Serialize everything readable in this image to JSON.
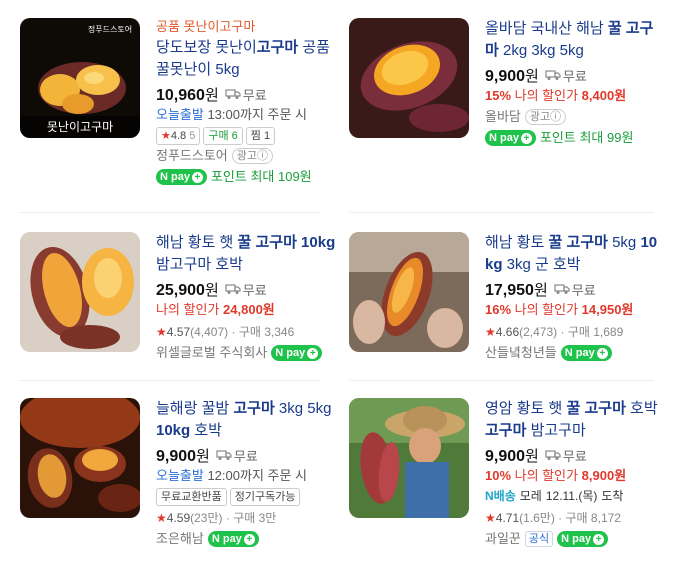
{
  "products": [
    {
      "brand_top": "공품 못난이고구마",
      "title_prefix": "당도보장 못난이",
      "title_bold": "고구마",
      "title_rest": " 공품 꿀못난이 5kg",
      "price": "10,960",
      "won": "원",
      "ship_label": "무료",
      "today_label": "오늘출발",
      "today_rest": " 13:00까지 주문 시",
      "tag_rating": "4.8",
      "tag_rating_count": "5",
      "tag_buy": "구매 6",
      "tag_zzim": "찜 1",
      "seller": "정푸드스토어",
      "ad_label": "광고ⓘ",
      "npay": "N pay",
      "point": "포인트 최대 109원",
      "thumb_label": "못난이고구마",
      "thumb_brand": "정푸드스토어"
    },
    {
      "title_prefix": "올바담 국내산 해남 ",
      "title_bold": "꿀 고구마",
      "title_rest": " 2kg 3kg 5kg",
      "price": "9,900",
      "won": "원",
      "ship_label": "무료",
      "disc_pct": "15%",
      "disc_label": " 나의 할인가 ",
      "disc_price": "8,400원",
      "seller": "올바담",
      "ad_label": "광고ⓘ",
      "npay": "N pay",
      "point": "포인트 최대 99원"
    },
    {
      "title_prefix": "해남 황토 햇 ",
      "title_bold": "꿀 고구마 10kg",
      "title_rest": " 밤고구마 호박",
      "price": "25,900",
      "won": "원",
      "ship_label": "무료",
      "disc_label": "나의 할인가 ",
      "disc_price": "24,800원",
      "rating": "4.57",
      "review_count": "(4,407)",
      "buy": "구매 3,346",
      "seller": "위셀글로벌 주식회사",
      "npay": "N pay"
    },
    {
      "title_prefix": "해남 황토 ",
      "title_bold": "꿀 고구마",
      "title_rest": " 5kg ",
      "title_bold2": "10kg",
      "title_rest2": " 3kg 군 호박",
      "price": "17,950",
      "won": "원",
      "ship_label": "무료",
      "disc_pct": "16%",
      "disc_label": " 나의 할인가 ",
      "disc_price": "14,950원",
      "rating": "4.66",
      "review_count": "(2,473)",
      "buy": "구매 1,689",
      "seller": "산들녘청년들",
      "npay": "N pay"
    },
    {
      "title_prefix": "늘해랑 꿀밤 ",
      "title_bold": "고구마",
      "title_rest": " 3kg 5kg ",
      "title_bold2": "10kg",
      "title_rest2": " 호박",
      "price": "9,900",
      "won": "원",
      "ship_label": "무료",
      "today_label": "오늘출발",
      "today_rest": " 12:00까지 주문 시",
      "tag1": "무료교환반품",
      "tag2": "정기구독가능",
      "rating": "4.59",
      "review_count": "(23만)",
      "buy": "구매 3만",
      "seller": "조은해남",
      "npay": "N pay"
    },
    {
      "title_prefix": "영암 황토 햇 ",
      "title_bold": "꿀 고구마",
      "title_rest": " 호박",
      "title_bold2": "고구마",
      "title_rest2": " 밤고구마",
      "price": "9,900",
      "won": "원",
      "ship_label": "무료",
      "disc_pct": "10%",
      "disc_label": " 나의 할인가 ",
      "disc_price": "8,900원",
      "delivery_brand": "N배송",
      "delivery_text": "모레",
      "delivery_date": "12.11.(목)",
      "delivery_suffix": "도착",
      "rating": "4.71",
      "review_count": "(1.6만)",
      "buy": "구매 8,172",
      "seller": "과일꾼",
      "official_label": "공식",
      "npay": "N pay"
    }
  ],
  "colors": {
    "title_blue": "#1a3b8c",
    "discount_red": "#e0392b",
    "npay_green": "#1fc24a"
  }
}
